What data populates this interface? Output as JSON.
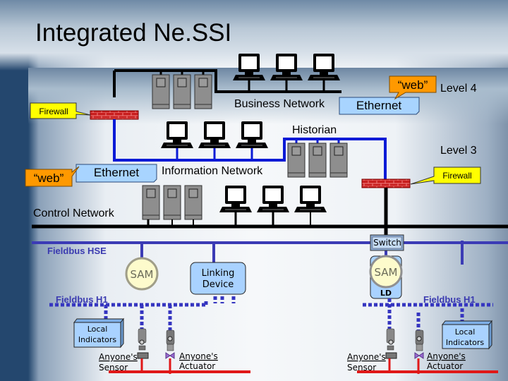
{
  "title": "Integrated Ne.SSI",
  "colors": {
    "business_network": "#000000",
    "information_network": "#0a1ad6",
    "control_network": "#000000",
    "fieldbus_hse": "#3b3bb5",
    "fieldbus_h1": "#3535c0",
    "process_line": "#e01818",
    "firewall": "#c81e1e",
    "callout_yellow": "#ffff00",
    "callout_orange": "#ff9900",
    "callout_blue": "#a8d4ff",
    "device_fill": "#a9d2ff",
    "sam_fill": "#fdfbcc"
  },
  "levels": {
    "level4": "Level 4",
    "level3": "Level 3"
  },
  "networks": {
    "business": "Business Network",
    "information": "Information Network",
    "control": "Control Network",
    "historian": "Historian",
    "fieldbus_hse": "Fieldbus HSE",
    "fieldbus_h1_left": "Fieldbus H1",
    "fieldbus_h1_right": "Fieldbus H1"
  },
  "callouts": {
    "firewall_top": "Firewall",
    "firewall_right": "Firewall",
    "web_top": "“web”",
    "ethernet_top": "Ethernet",
    "web_left": "“web”",
    "ethernet_left": "Ethernet"
  },
  "devices": {
    "switch": "Switch",
    "sam_left": "SAM",
    "sam_right": "SAM",
    "ld": "LD",
    "linking_device_line1": "Linking",
    "linking_device_line2": "Device",
    "local_indicators_left_line1": "Local",
    "local_indicators_left_line2": "Indicators",
    "local_indicators_right_line1": "Local",
    "local_indicators_right_line2": "Indicators"
  },
  "field": {
    "sensor_left_line1": "Anyone's",
    "sensor_left_line2": "Sensor",
    "actuator_left_line1": "Anyone's",
    "actuator_left_line2": "Actuator",
    "sensor_right_line1": "Anyone's",
    "sensor_right_line2": "Sensor",
    "actuator_right_line1": "Anyone's",
    "actuator_right_line2": "Actuator"
  }
}
